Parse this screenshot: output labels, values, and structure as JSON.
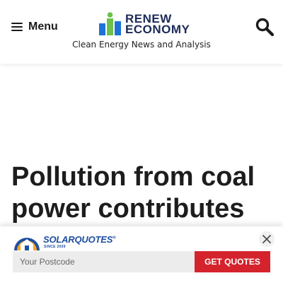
{
  "header": {
    "menu_label": "Menu",
    "logo_line1": "RENEW",
    "logo_line2": "ECONOMY",
    "tagline": "Clean Energy News and Analysis",
    "icons": {
      "menu": "hamburger-icon",
      "search": "search-icon"
    }
  },
  "article": {
    "headline": "Pollution from coal power contributes to"
  },
  "ad": {
    "brand": "SOLARQUOTES",
    "trademark": "®",
    "since": "SINCE 2009",
    "postcode_placeholder": "Your Postcode",
    "button_label": "GET QUOTES",
    "icons": {
      "close": "close-icon"
    }
  },
  "colors": {
    "logo_navy": "#1c2a57",
    "logo_blue": "#1e73d8",
    "logo_green": "#6cc24a",
    "cta_red": "#d4232c",
    "solarquotes_blue": "#1f4fa0"
  }
}
